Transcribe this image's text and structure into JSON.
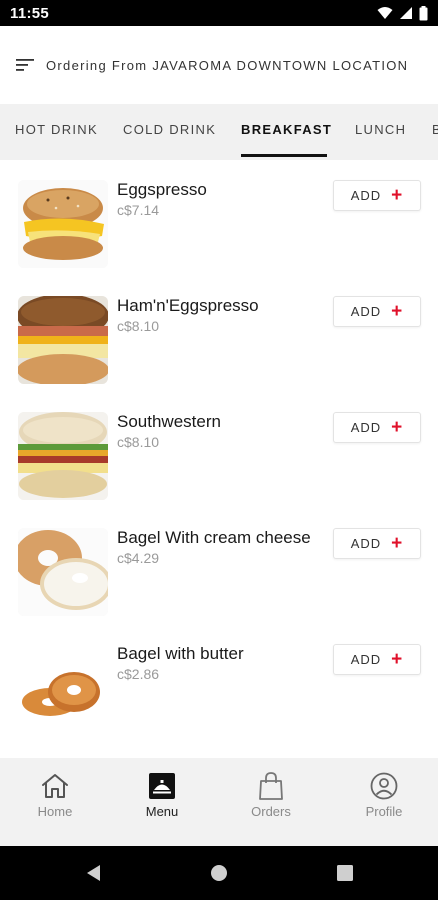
{
  "status_bar": {
    "time": "11:55"
  },
  "header": {
    "text": "Ordering From JAVAROMA DOWNTOWN LOCATION",
    "menu_icon": "hamburger-icon"
  },
  "tabs": [
    {
      "label": "HOT DRINK",
      "active": false
    },
    {
      "label": "COLD DRINK",
      "active": false
    },
    {
      "label": "BREAKFAST",
      "active": true
    },
    {
      "label": "LUNCH",
      "active": false
    },
    {
      "label": "B",
      "active": false
    }
  ],
  "menu_items": [
    {
      "name": "Eggspresso",
      "price": "c$7.14",
      "add_label": "ADD",
      "add_icon": "+"
    },
    {
      "name": "Ham'n'Eggspresso",
      "price": "c$8.10",
      "add_label": "ADD",
      "add_icon": "+"
    },
    {
      "name": "Southwestern",
      "price": "c$8.10",
      "add_label": "ADD",
      "add_icon": "+"
    },
    {
      "name": "Bagel With cream cheese",
      "price": "c$4.29",
      "add_label": "ADD",
      "add_icon": "+"
    },
    {
      "name": "Bagel with butter",
      "price": "c$2.86",
      "add_label": "ADD",
      "add_icon": "+"
    }
  ],
  "bottom_nav": [
    {
      "label": "Home",
      "icon": "home-icon",
      "active": false
    },
    {
      "label": "Menu",
      "icon": "menu-icon",
      "active": true
    },
    {
      "label": "Orders",
      "icon": "bag-icon",
      "active": false
    },
    {
      "label": "Profile",
      "icon": "profile-icon",
      "active": false
    }
  ],
  "colors": {
    "accent": "#e0102a",
    "tab_bar_bg": "#f1f1f1",
    "nav_bg": "#f2f2f2"
  }
}
